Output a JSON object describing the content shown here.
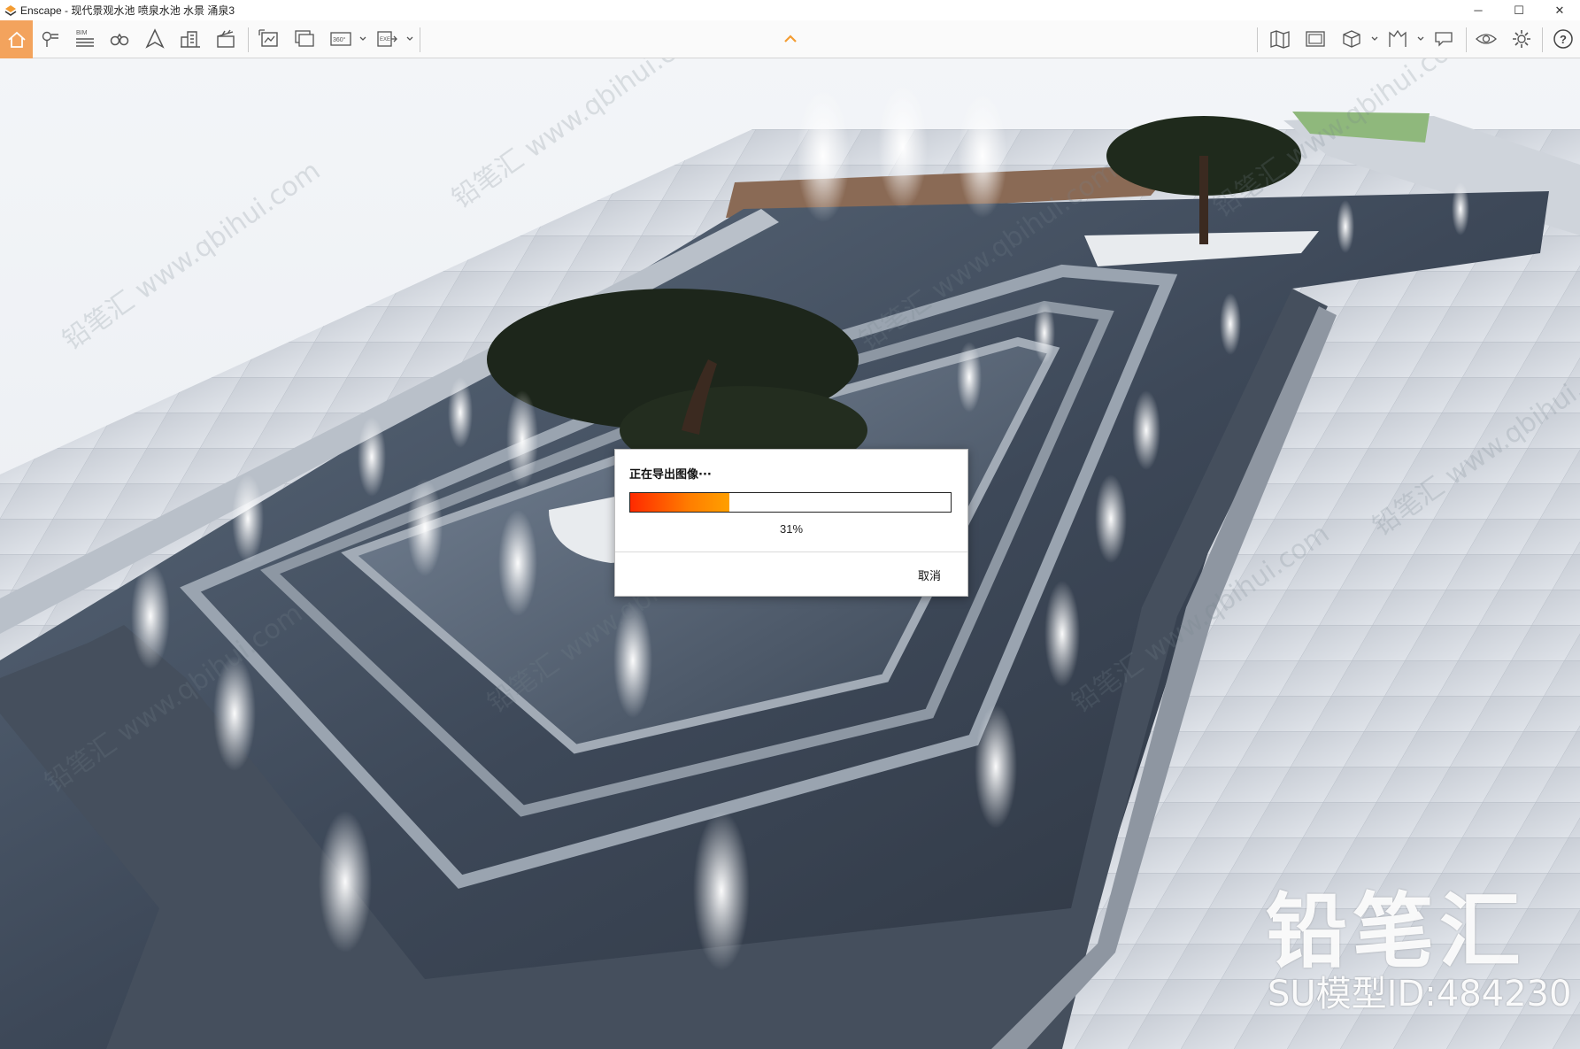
{
  "window": {
    "title": "Enscape - 现代景观水池 喷泉水池 水景 涌泉3",
    "controls": {
      "minimize": "─",
      "maximize": "☐",
      "close": "✕"
    }
  },
  "toolbar": {
    "left_icons": [
      "home-icon",
      "location-pin-icon",
      "bim-icon",
      "binoculars-icon",
      "navigation-icon",
      "buildings-icon",
      "clapperboard-icon",
      "screenshot-icon",
      "batch-render-icon",
      "panorama-360-icon",
      "export-exe-icon"
    ],
    "bim_label": "BIM",
    "pano_label": "360°",
    "exe_label": "EXE",
    "right_icons": [
      "map-icon",
      "gallery-icon",
      "cube-view-icon",
      "asset-library-icon",
      "chat-icon",
      "eye-visual-settings-icon",
      "gear-icon",
      "help-icon"
    ],
    "help_label": "?",
    "accent_color": "#f3a35d"
  },
  "export_dialog": {
    "title": "正在导出图像···",
    "progress_fraction": 0.31,
    "progress_text": "31%",
    "cancel_label": "取消"
  },
  "watermark": {
    "logo_text": "铅笔汇",
    "model_id": "SU模型ID:484230",
    "repeat_text": "铅笔汇 www.qbihui.com"
  }
}
